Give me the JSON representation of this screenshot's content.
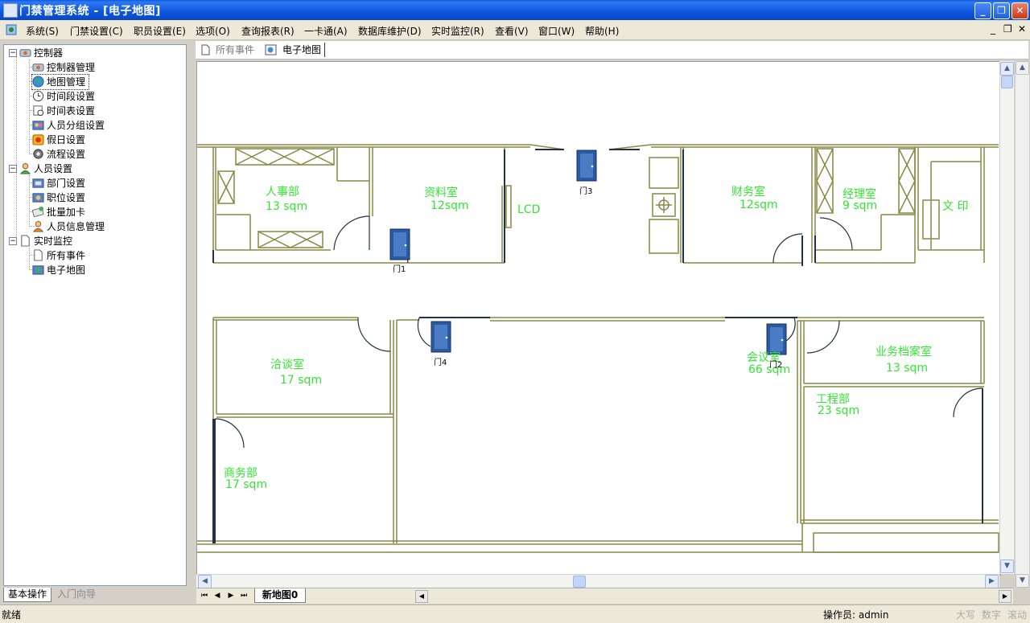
{
  "window": {
    "title": "门禁管理系统 - [电子地图]",
    "minimize": "_",
    "restore": "❐",
    "close": "✕"
  },
  "menu": {
    "items": [
      "系统(S)",
      "门禁设置(C)",
      "职员设置(E)",
      "选项(O)",
      "查询报表(R)",
      "一卡通(A)",
      "数据库维护(D)",
      "实时监控(R)",
      "查看(V)",
      "窗口(W)",
      "帮助(H)"
    ],
    "mdi_min": "_",
    "mdi_restore": "❐",
    "mdi_close": "✕"
  },
  "tree": {
    "controller": {
      "label": "控制器",
      "children": [
        "控制器管理",
        "地图管理",
        "时间段设置",
        "时间表设置",
        "人员分组设置",
        "假日设置",
        "流程设置"
      ]
    },
    "personnel": {
      "label": "人员设置",
      "children": [
        "部门设置",
        "职位设置",
        "批量加卡",
        "人员信息管理"
      ]
    },
    "monitor": {
      "label": "实时监控",
      "children": [
        "所有事件",
        "电子地图"
      ]
    }
  },
  "left_tabs": {
    "basic": "基本操作",
    "guide": "入门向导"
  },
  "doc_tabs": {
    "events": "所有事件",
    "map": "电子地图"
  },
  "map": {
    "rooms": {
      "hr": {
        "name": "人事部",
        "area": "13 sqm"
      },
      "archive": {
        "name": "资料室",
        "area": "12sqm"
      },
      "lcd": "LCD",
      "finance": {
        "name": "财务室",
        "area": "12sqm"
      },
      "manager": {
        "name": "经理室",
        "area": "9 sqm"
      },
      "print": "文 印",
      "negotiate": {
        "name": "洽谈室",
        "area": "17 sqm"
      },
      "meeting": {
        "name": "会议室",
        "area": "66 sqm"
      },
      "records": {
        "name": "业务档案室",
        "area": "13 sqm"
      },
      "engineering": {
        "name": "工程部",
        "area": "23 sqm"
      },
      "business": {
        "name": "商务部",
        "area": "17 sqm"
      }
    },
    "doors": [
      "门1",
      "门2",
      "门3",
      "门4"
    ]
  },
  "sheet_tab": "新地图0",
  "status": {
    "ready": "就绪",
    "operator": "操作员: admin",
    "caps": "大写",
    "num": "数字",
    "scroll": "滚动"
  },
  "colors": {
    "wall": "#888844",
    "label": "#33e633",
    "door": "#2c5aa0",
    "titlebar": "#0b56df"
  }
}
